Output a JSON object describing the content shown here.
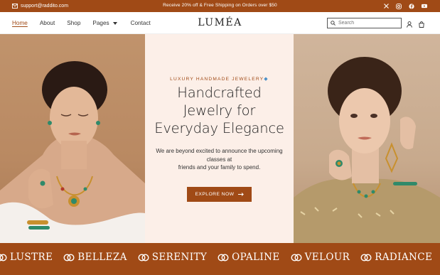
{
  "topbar": {
    "email": "support@raddito.com",
    "promo": "Receive 20% off & Free Shipping on Orders over $50",
    "socials": [
      "x-icon",
      "instagram-icon",
      "facebook-icon",
      "youtube-icon"
    ]
  },
  "header": {
    "logo": "LUMÉA",
    "nav": {
      "home": "Home",
      "about": "About",
      "shop": "Shop",
      "pages": "Pages",
      "contact": "Contact"
    },
    "search": {
      "value": "",
      "placeholder": "Search"
    }
  },
  "hero": {
    "eyebrow": "LUXURY HANDMADE JEWELERY",
    "title_lines": [
      "Handcrafted",
      "Jewelry for",
      "Everyday Elegance"
    ],
    "desc_lines": [
      "We are beyond excited to announce the upcoming",
      "classes at",
      "friends and your family to spend."
    ],
    "cta": "EXPLORE NOW"
  },
  "band": {
    "items": [
      "LUSTRE",
      "BELLEZA",
      "SERENITY",
      "OPALINE",
      "VELOUR",
      "RADIANCE",
      "LUSTRE"
    ]
  },
  "colors": {
    "accent": "#a04a16",
    "hero_center_bg": "#fcefe8"
  }
}
